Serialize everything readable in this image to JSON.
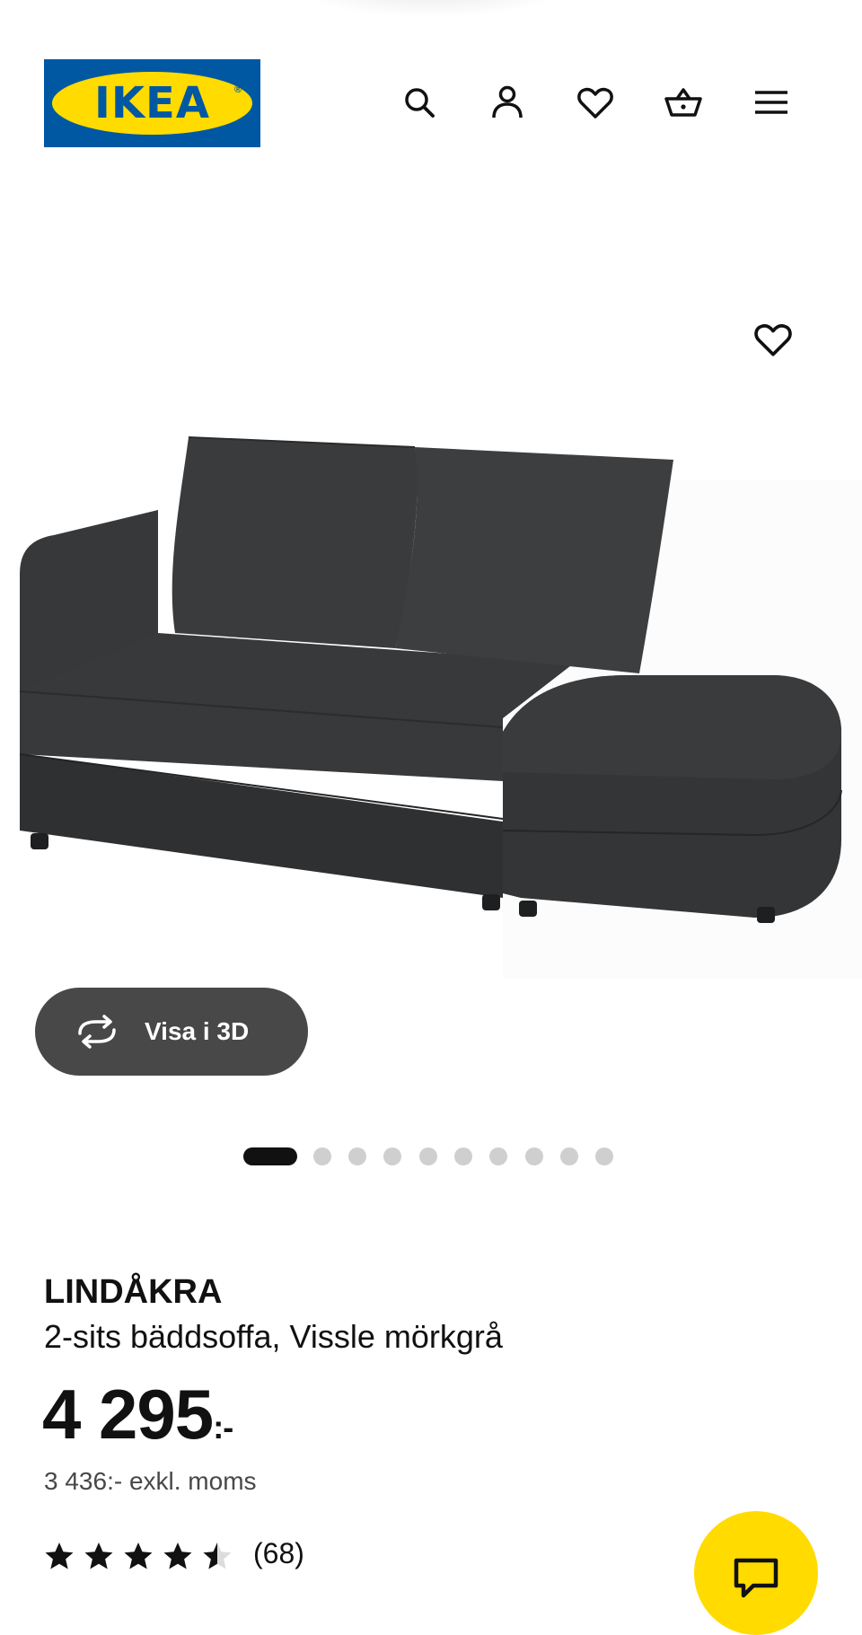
{
  "header": {
    "logo_text": "IKEA",
    "logo_reg": "®",
    "icons": [
      "search-icon",
      "account-icon",
      "favourites-icon",
      "basket-icon",
      "menu-icon"
    ]
  },
  "gallery": {
    "view_3d_label": "Visa i 3D",
    "image_count": 10,
    "active_index": 0
  },
  "product": {
    "name": "LINDÅKRA",
    "description": "2-sits bäddsoffa, Vissle mörkgrå",
    "price": "4 295",
    "price_suffix": ":-",
    "price_excl_vat": "3 436:- exkl. moms",
    "rating": 4.5,
    "review_count": "(68)"
  },
  "colors": {
    "ikea_blue": "#0058a3",
    "ikea_yellow": "#ffdb00",
    "sofa": "#353638",
    "button_dark": "#484848"
  }
}
